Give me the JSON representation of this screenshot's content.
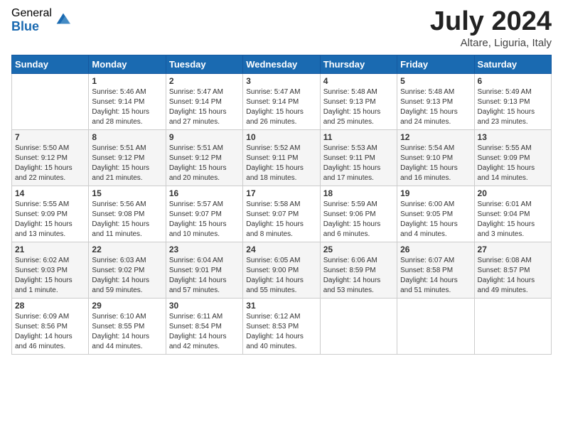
{
  "logo": {
    "general": "General",
    "blue": "Blue"
  },
  "title": "July 2024",
  "subtitle": "Altare, Liguria, Italy",
  "weekdays": [
    "Sunday",
    "Monday",
    "Tuesday",
    "Wednesday",
    "Thursday",
    "Friday",
    "Saturday"
  ],
  "weeks": [
    [
      {
        "day": "",
        "info": ""
      },
      {
        "day": "1",
        "info": "Sunrise: 5:46 AM\nSunset: 9:14 PM\nDaylight: 15 hours\nand 28 minutes."
      },
      {
        "day": "2",
        "info": "Sunrise: 5:47 AM\nSunset: 9:14 PM\nDaylight: 15 hours\nand 27 minutes."
      },
      {
        "day": "3",
        "info": "Sunrise: 5:47 AM\nSunset: 9:14 PM\nDaylight: 15 hours\nand 26 minutes."
      },
      {
        "day": "4",
        "info": "Sunrise: 5:48 AM\nSunset: 9:13 PM\nDaylight: 15 hours\nand 25 minutes."
      },
      {
        "day": "5",
        "info": "Sunrise: 5:48 AM\nSunset: 9:13 PM\nDaylight: 15 hours\nand 24 minutes."
      },
      {
        "day": "6",
        "info": "Sunrise: 5:49 AM\nSunset: 9:13 PM\nDaylight: 15 hours\nand 23 minutes."
      }
    ],
    [
      {
        "day": "7",
        "info": "Sunrise: 5:50 AM\nSunset: 9:12 PM\nDaylight: 15 hours\nand 22 minutes."
      },
      {
        "day": "8",
        "info": "Sunrise: 5:51 AM\nSunset: 9:12 PM\nDaylight: 15 hours\nand 21 minutes."
      },
      {
        "day": "9",
        "info": "Sunrise: 5:51 AM\nSunset: 9:12 PM\nDaylight: 15 hours\nand 20 minutes."
      },
      {
        "day": "10",
        "info": "Sunrise: 5:52 AM\nSunset: 9:11 PM\nDaylight: 15 hours\nand 18 minutes."
      },
      {
        "day": "11",
        "info": "Sunrise: 5:53 AM\nSunset: 9:11 PM\nDaylight: 15 hours\nand 17 minutes."
      },
      {
        "day": "12",
        "info": "Sunrise: 5:54 AM\nSunset: 9:10 PM\nDaylight: 15 hours\nand 16 minutes."
      },
      {
        "day": "13",
        "info": "Sunrise: 5:55 AM\nSunset: 9:09 PM\nDaylight: 15 hours\nand 14 minutes."
      }
    ],
    [
      {
        "day": "14",
        "info": "Sunrise: 5:55 AM\nSunset: 9:09 PM\nDaylight: 15 hours\nand 13 minutes."
      },
      {
        "day": "15",
        "info": "Sunrise: 5:56 AM\nSunset: 9:08 PM\nDaylight: 15 hours\nand 11 minutes."
      },
      {
        "day": "16",
        "info": "Sunrise: 5:57 AM\nSunset: 9:07 PM\nDaylight: 15 hours\nand 10 minutes."
      },
      {
        "day": "17",
        "info": "Sunrise: 5:58 AM\nSunset: 9:07 PM\nDaylight: 15 hours\nand 8 minutes."
      },
      {
        "day": "18",
        "info": "Sunrise: 5:59 AM\nSunset: 9:06 PM\nDaylight: 15 hours\nand 6 minutes."
      },
      {
        "day": "19",
        "info": "Sunrise: 6:00 AM\nSunset: 9:05 PM\nDaylight: 15 hours\nand 4 minutes."
      },
      {
        "day": "20",
        "info": "Sunrise: 6:01 AM\nSunset: 9:04 PM\nDaylight: 15 hours\nand 3 minutes."
      }
    ],
    [
      {
        "day": "21",
        "info": "Sunrise: 6:02 AM\nSunset: 9:03 PM\nDaylight: 15 hours\nand 1 minute."
      },
      {
        "day": "22",
        "info": "Sunrise: 6:03 AM\nSunset: 9:02 PM\nDaylight: 14 hours\nand 59 minutes."
      },
      {
        "day": "23",
        "info": "Sunrise: 6:04 AM\nSunset: 9:01 PM\nDaylight: 14 hours\nand 57 minutes."
      },
      {
        "day": "24",
        "info": "Sunrise: 6:05 AM\nSunset: 9:00 PM\nDaylight: 14 hours\nand 55 minutes."
      },
      {
        "day": "25",
        "info": "Sunrise: 6:06 AM\nSunset: 8:59 PM\nDaylight: 14 hours\nand 53 minutes."
      },
      {
        "day": "26",
        "info": "Sunrise: 6:07 AM\nSunset: 8:58 PM\nDaylight: 14 hours\nand 51 minutes."
      },
      {
        "day": "27",
        "info": "Sunrise: 6:08 AM\nSunset: 8:57 PM\nDaylight: 14 hours\nand 49 minutes."
      }
    ],
    [
      {
        "day": "28",
        "info": "Sunrise: 6:09 AM\nSunset: 8:56 PM\nDaylight: 14 hours\nand 46 minutes."
      },
      {
        "day": "29",
        "info": "Sunrise: 6:10 AM\nSunset: 8:55 PM\nDaylight: 14 hours\nand 44 minutes."
      },
      {
        "day": "30",
        "info": "Sunrise: 6:11 AM\nSunset: 8:54 PM\nDaylight: 14 hours\nand 42 minutes."
      },
      {
        "day": "31",
        "info": "Sunrise: 6:12 AM\nSunset: 8:53 PM\nDaylight: 14 hours\nand 40 minutes."
      },
      {
        "day": "",
        "info": ""
      },
      {
        "day": "",
        "info": ""
      },
      {
        "day": "",
        "info": ""
      }
    ]
  ]
}
